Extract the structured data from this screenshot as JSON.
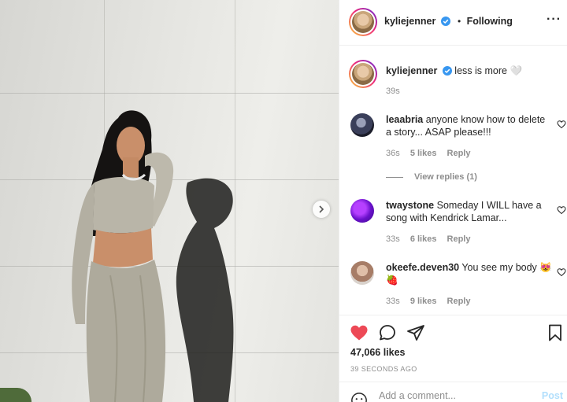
{
  "post": {
    "username": "kyliejenner",
    "follow_status": "Following",
    "more_icon": "more-options-icon",
    "caption": {
      "username": "kyliejenner",
      "text": "less is more 🤍",
      "time": "39s"
    }
  },
  "comments": [
    {
      "username": "leaabria",
      "text": "anyone know how to delete a story... ASAP please!!!",
      "time": "36s",
      "likes": "5 likes",
      "reply": "Reply"
    },
    {
      "username": "twaystone",
      "text": "Someday I WILL have a song with Kendrick Lamar...",
      "time": "33s",
      "likes": "6 likes",
      "reply": "Reply"
    },
    {
      "username": "okeefe.deven30",
      "text": "You see my body 😻🍓",
      "time": "33s",
      "likes": "9 likes",
      "reply": "Reply"
    }
  ],
  "view_replies": "View replies (1)",
  "like_count": "47,066 likes",
  "posted_ago": "39 SECONDS AGO",
  "comment_box": {
    "placeholder": "Add a comment...",
    "post_label": "Post"
  },
  "colors": {
    "like_red": "#ed4956",
    "verified_blue": "#3897f0",
    "post_disabled_blue": "#b2dffc",
    "muted_gray": "#8e8e8e"
  }
}
